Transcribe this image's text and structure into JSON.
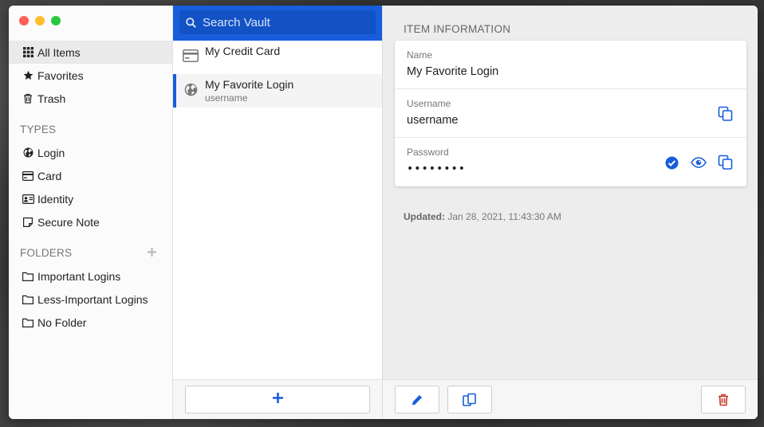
{
  "colors": {
    "accent": "#175ddc",
    "danger": "#c83522",
    "close": "#fe5f57",
    "minimize": "#febc2e",
    "zoom": "#28c840"
  },
  "sidebar": {
    "items": [
      {
        "label": "All Items",
        "icon": "grid-icon"
      },
      {
        "label": "Favorites",
        "icon": "star-icon"
      },
      {
        "label": "Trash",
        "icon": "trash-icon"
      }
    ],
    "types_heading": "TYPES",
    "types": [
      {
        "label": "Login",
        "icon": "globe-icon"
      },
      {
        "label": "Card",
        "icon": "credit-card-icon"
      },
      {
        "label": "Identity",
        "icon": "id-card-icon"
      },
      {
        "label": "Secure Note",
        "icon": "sticky-note-icon"
      }
    ],
    "folders_heading": "FOLDERS",
    "folders": [
      {
        "label": "Important Logins",
        "icon": "folder-icon"
      },
      {
        "label": "Less-Important Logins",
        "icon": "folder-icon"
      },
      {
        "label": "No Folder",
        "icon": "folder-icon"
      }
    ]
  },
  "search": {
    "placeholder": "Search Vault"
  },
  "list": {
    "items": [
      {
        "title": "My Credit Card",
        "subtitle": "",
        "icon": "credit-card-icon"
      },
      {
        "title": "My Favorite Login",
        "subtitle": "username",
        "icon": "globe-icon"
      }
    ]
  },
  "detail": {
    "heading": "ITEM INFORMATION",
    "fields": {
      "name": {
        "label": "Name",
        "value": "My Favorite Login"
      },
      "username": {
        "label": "Username",
        "value": "username"
      },
      "password": {
        "label": "Password",
        "value": "••••••••"
      }
    },
    "updated_label": "Updated:",
    "updated_value": "Jan 28, 2021, 11:43:30 AM"
  }
}
